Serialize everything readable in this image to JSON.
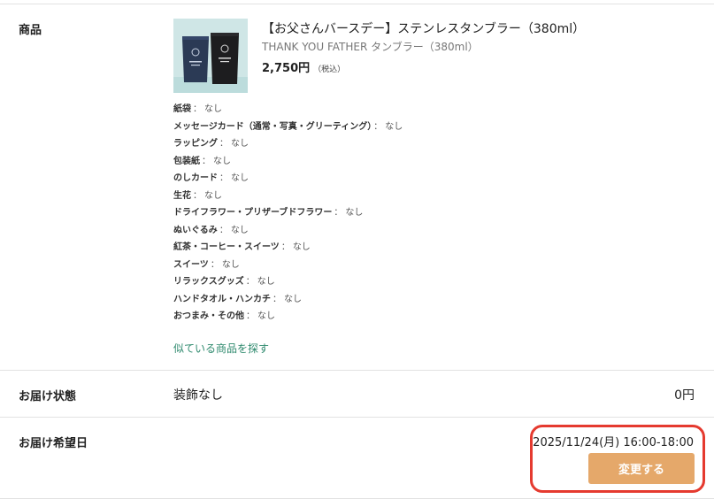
{
  "product_row": {
    "label": "商品",
    "title": "【お父さんバースデー】ステンレスタンブラー（380ml）",
    "subtitle": "THANK YOU FATHER タンブラー（380ml）",
    "price": "2,750円",
    "tax_note": "（税込）",
    "image_icon": "tumbler-product-image",
    "options": [
      {
        "key": "紙袋",
        "value": "なし"
      },
      {
        "key": "メッセージカード（通常・写真・グリーティング）",
        "value": "なし"
      },
      {
        "key": "ラッピング",
        "value": "なし"
      },
      {
        "key": "包装紙",
        "value": "なし"
      },
      {
        "key": "のしカード",
        "value": "なし"
      },
      {
        "key": "生花",
        "value": "なし"
      },
      {
        "key": "ドライフラワー・プリザーブドフラワー",
        "value": "なし"
      },
      {
        "key": "ぬいぐるみ",
        "value": "なし"
      },
      {
        "key": "紅茶・コーヒー・スイーツ",
        "value": "なし"
      },
      {
        "key": "スイーツ",
        "value": "なし"
      },
      {
        "key": "リラックスグッズ",
        "value": "なし"
      },
      {
        "key": "ハンドタオル・ハンカチ",
        "value": "なし"
      },
      {
        "key": "おつまみ・その他",
        "value": "なし"
      }
    ],
    "option_separator": "：",
    "similar_link": "似ている商品を探す"
  },
  "status_row": {
    "label": "お届け状態",
    "value": "装飾なし",
    "price": "0円"
  },
  "date_row": {
    "label": "お届け希望日",
    "value": "2025/11/24(月) 16:00-18:00",
    "change_button": "変更する"
  },
  "colors": {
    "link": "#2f8a6e",
    "button": "#e5a86a",
    "highlight": "#e53a2f",
    "divider": "#e2e2e2"
  }
}
